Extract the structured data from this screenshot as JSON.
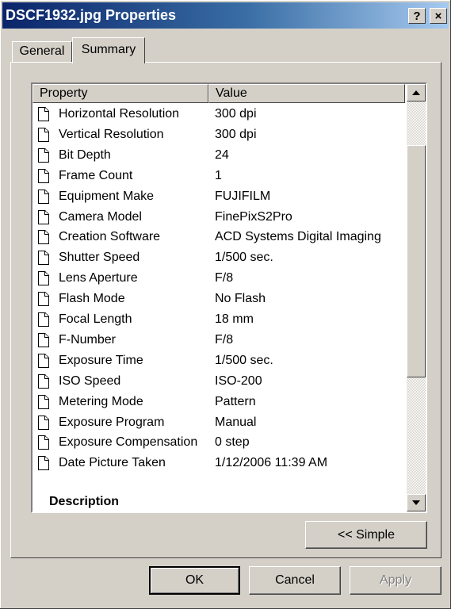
{
  "window": {
    "title": "DSCF1932.jpg Properties",
    "help_label": "?",
    "close_label": "×"
  },
  "tabs": [
    {
      "label": "General",
      "active": false
    },
    {
      "label": "Summary",
      "active": true
    }
  ],
  "list": {
    "columns": {
      "property": "Property",
      "value": "Value"
    },
    "rows": [
      {
        "property": "Horizontal Resolution",
        "value": "300 dpi"
      },
      {
        "property": "Vertical Resolution",
        "value": "300 dpi"
      },
      {
        "property": "Bit Depth",
        "value": "24"
      },
      {
        "property": "Frame Count",
        "value": "1"
      },
      {
        "property": "Equipment Make",
        "value": "FUJIFILM"
      },
      {
        "property": "Camera Model",
        "value": "FinePixS2Pro"
      },
      {
        "property": "Creation Software",
        "value": "ACD Systems Digital Imaging"
      },
      {
        "property": "Shutter Speed",
        "value": "1/500 sec."
      },
      {
        "property": "Lens Aperture",
        "value": "F/8"
      },
      {
        "property": "Flash Mode",
        "value": "No Flash"
      },
      {
        "property": "Focal Length",
        "value": "18 mm"
      },
      {
        "property": "F-Number",
        "value": "F/8"
      },
      {
        "property": "Exposure Time",
        "value": "1/500 sec."
      },
      {
        "property": "ISO Speed",
        "value": "ISO-200"
      },
      {
        "property": "Metering Mode",
        "value": "Pattern"
      },
      {
        "property": "Exposure Program",
        "value": "Manual"
      },
      {
        "property": "Exposure Compensation",
        "value": "0 step"
      },
      {
        "property": "Date Picture Taken",
        "value": "1/12/2006 11:39 AM"
      }
    ],
    "section_heading": "Description",
    "icon": "document-icon"
  },
  "buttons": {
    "simple": "<< Simple",
    "ok": "OK",
    "cancel": "Cancel",
    "apply": "Apply"
  }
}
